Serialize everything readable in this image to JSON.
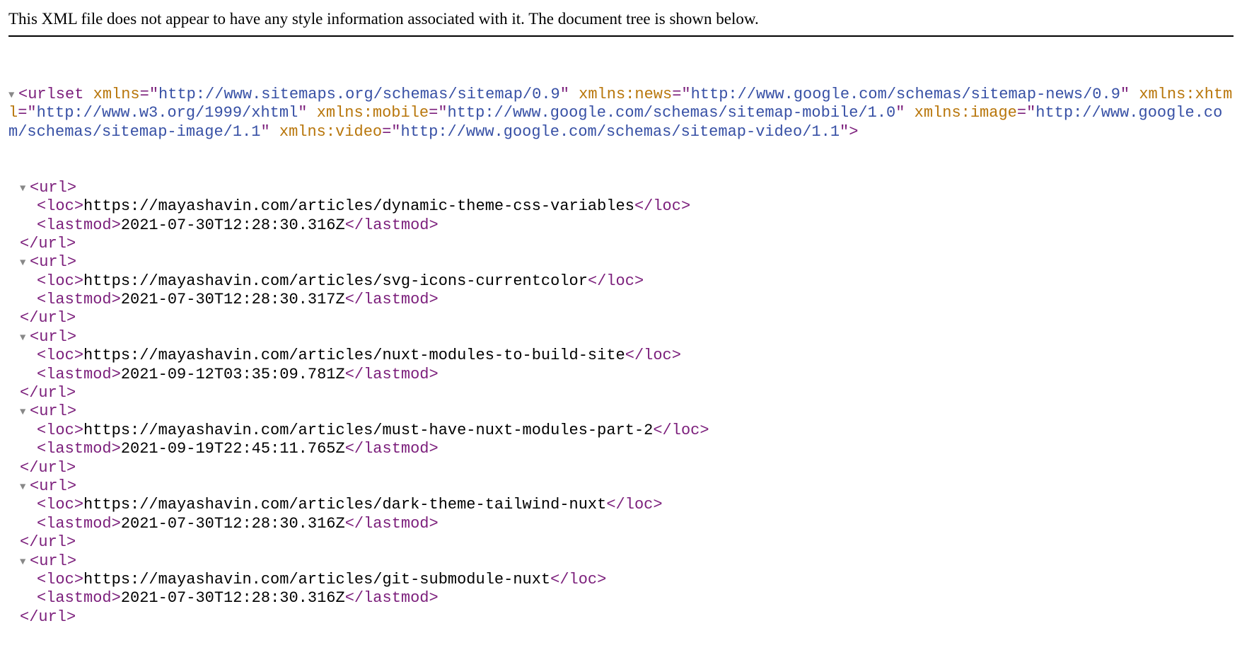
{
  "header": "This XML file does not appear to have any style information associated with it. The document tree is shown below.",
  "root": {
    "tag": "urlset",
    "attrs": [
      {
        "name": "xmlns",
        "value": "http://www.sitemaps.org/schemas/sitemap/0.9"
      },
      {
        "name": "xmlns:news",
        "value": "http://www.google.com/schemas/sitemap-news/0.9"
      },
      {
        "name": "xmlns:xhtml",
        "value": "http://www.w3.org/1999/xhtml"
      },
      {
        "name": "xmlns:mobile",
        "value": "http://www.google.com/schemas/sitemap-mobile/1.0"
      },
      {
        "name": "xmlns:image",
        "value": "http://www.google.com/schemas/sitemap-image/1.1"
      },
      {
        "name": "xmlns:video",
        "value": "http://www.google.com/schemas/sitemap-video/1.1"
      }
    ]
  },
  "urls": [
    {
      "loc": "https://mayashavin.com/articles/dynamic-theme-css-variables",
      "lastmod": "2021-07-30T12:28:30.316Z"
    },
    {
      "loc": "https://mayashavin.com/articles/svg-icons-currentcolor",
      "lastmod": "2021-07-30T12:28:30.317Z"
    },
    {
      "loc": "https://mayashavin.com/articles/nuxt-modules-to-build-site",
      "lastmod": "2021-09-12T03:35:09.781Z"
    },
    {
      "loc": "https://mayashavin.com/articles/must-have-nuxt-modules-part-2",
      "lastmod": "2021-09-19T22:45:11.765Z"
    },
    {
      "loc": "https://mayashavin.com/articles/dark-theme-tailwind-nuxt",
      "lastmod": "2021-07-30T12:28:30.316Z"
    },
    {
      "loc": "https://mayashavin.com/articles/git-submodule-nuxt",
      "lastmod": "2021-07-30T12:28:30.316Z"
    }
  ],
  "labels": {
    "url_tag": "url",
    "loc_tag": "loc",
    "lastmod_tag": "lastmod",
    "toggle_glyph": "▼"
  }
}
